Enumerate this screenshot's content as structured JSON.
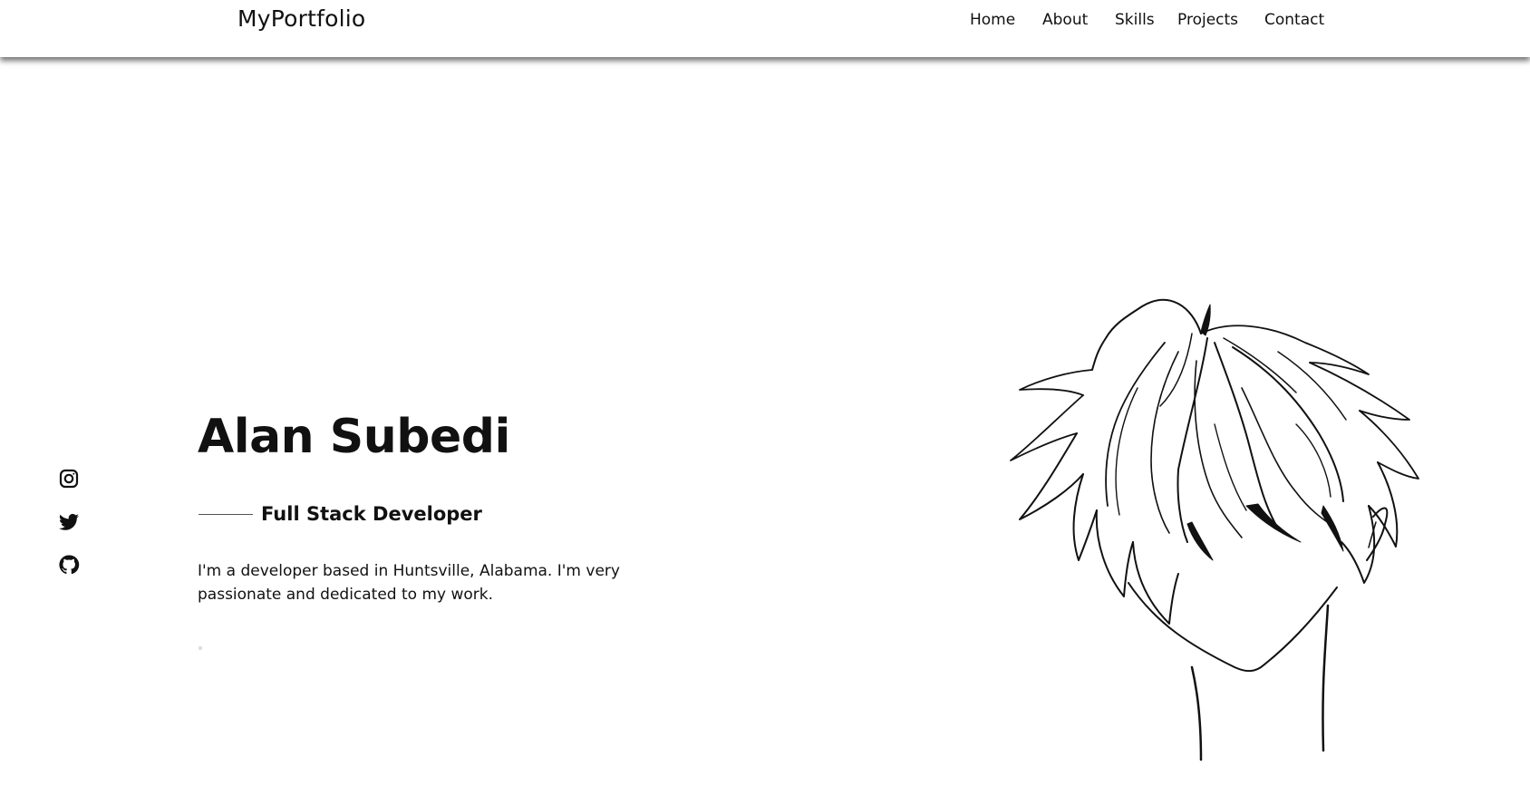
{
  "brand": {
    "logo": "MyPortfolio"
  },
  "nav": {
    "items": [
      {
        "label": "Home"
      },
      {
        "label": "About"
      },
      {
        "label": "Skills"
      },
      {
        "label": "Projects"
      },
      {
        "label": "Contact"
      }
    ]
  },
  "social": {
    "icons": [
      "instagram-icon",
      "twitter-icon",
      "github-icon"
    ]
  },
  "hero": {
    "name": "Alan Subedi",
    "role": "Full Stack Developer",
    "description": "I'm a developer based in Huntsville, Alabama. I'm very passionate and dedicated to my work."
  },
  "colors": {
    "text": "#111111",
    "background": "#ffffff"
  }
}
